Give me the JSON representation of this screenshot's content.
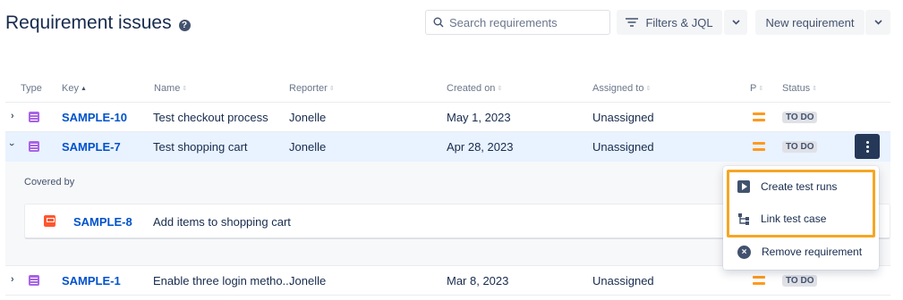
{
  "header": {
    "title": "Requirement issues",
    "help_icon": "?",
    "search_placeholder": "Search requirements",
    "filters_label": "Filters & JQL",
    "new_requirement_label": "New requirement"
  },
  "table": {
    "columns": [
      "Type",
      "Key",
      "Name",
      "Reporter",
      "Created on",
      "Assigned to",
      "P",
      "Status"
    ],
    "rows": [
      {
        "key": "SAMPLE-10",
        "name": "Test checkout process",
        "reporter": "Jonelle",
        "created": "May 1, 2023",
        "assigned": "Unassigned",
        "status": "TO DO"
      },
      {
        "key": "SAMPLE-7",
        "name": "Test shopping cart",
        "reporter": "Jonelle",
        "created": "Apr 28, 2023",
        "assigned": "Unassigned",
        "status": "TO DO"
      },
      {
        "key": "SAMPLE-1",
        "name": "Enable three login metho...",
        "reporter": "Jonelle",
        "created": "Mar 8, 2023",
        "assigned": "Unassigned",
        "status": "TO DO"
      }
    ]
  },
  "expanded": {
    "covered_by_label": "Covered by",
    "test_key": "SAMPLE-8",
    "test_name": "Add items to shopping cart"
  },
  "menu": {
    "items": [
      "Create test runs",
      "Link test case",
      "Remove requirement"
    ]
  },
  "colors": {
    "link": "#0052cc",
    "selected_row": "#e9f2ff",
    "highlight": "#f6a623",
    "priority": "#ff991f",
    "requirement_icon": "#a864e6",
    "test_icon": "#ff5630"
  }
}
